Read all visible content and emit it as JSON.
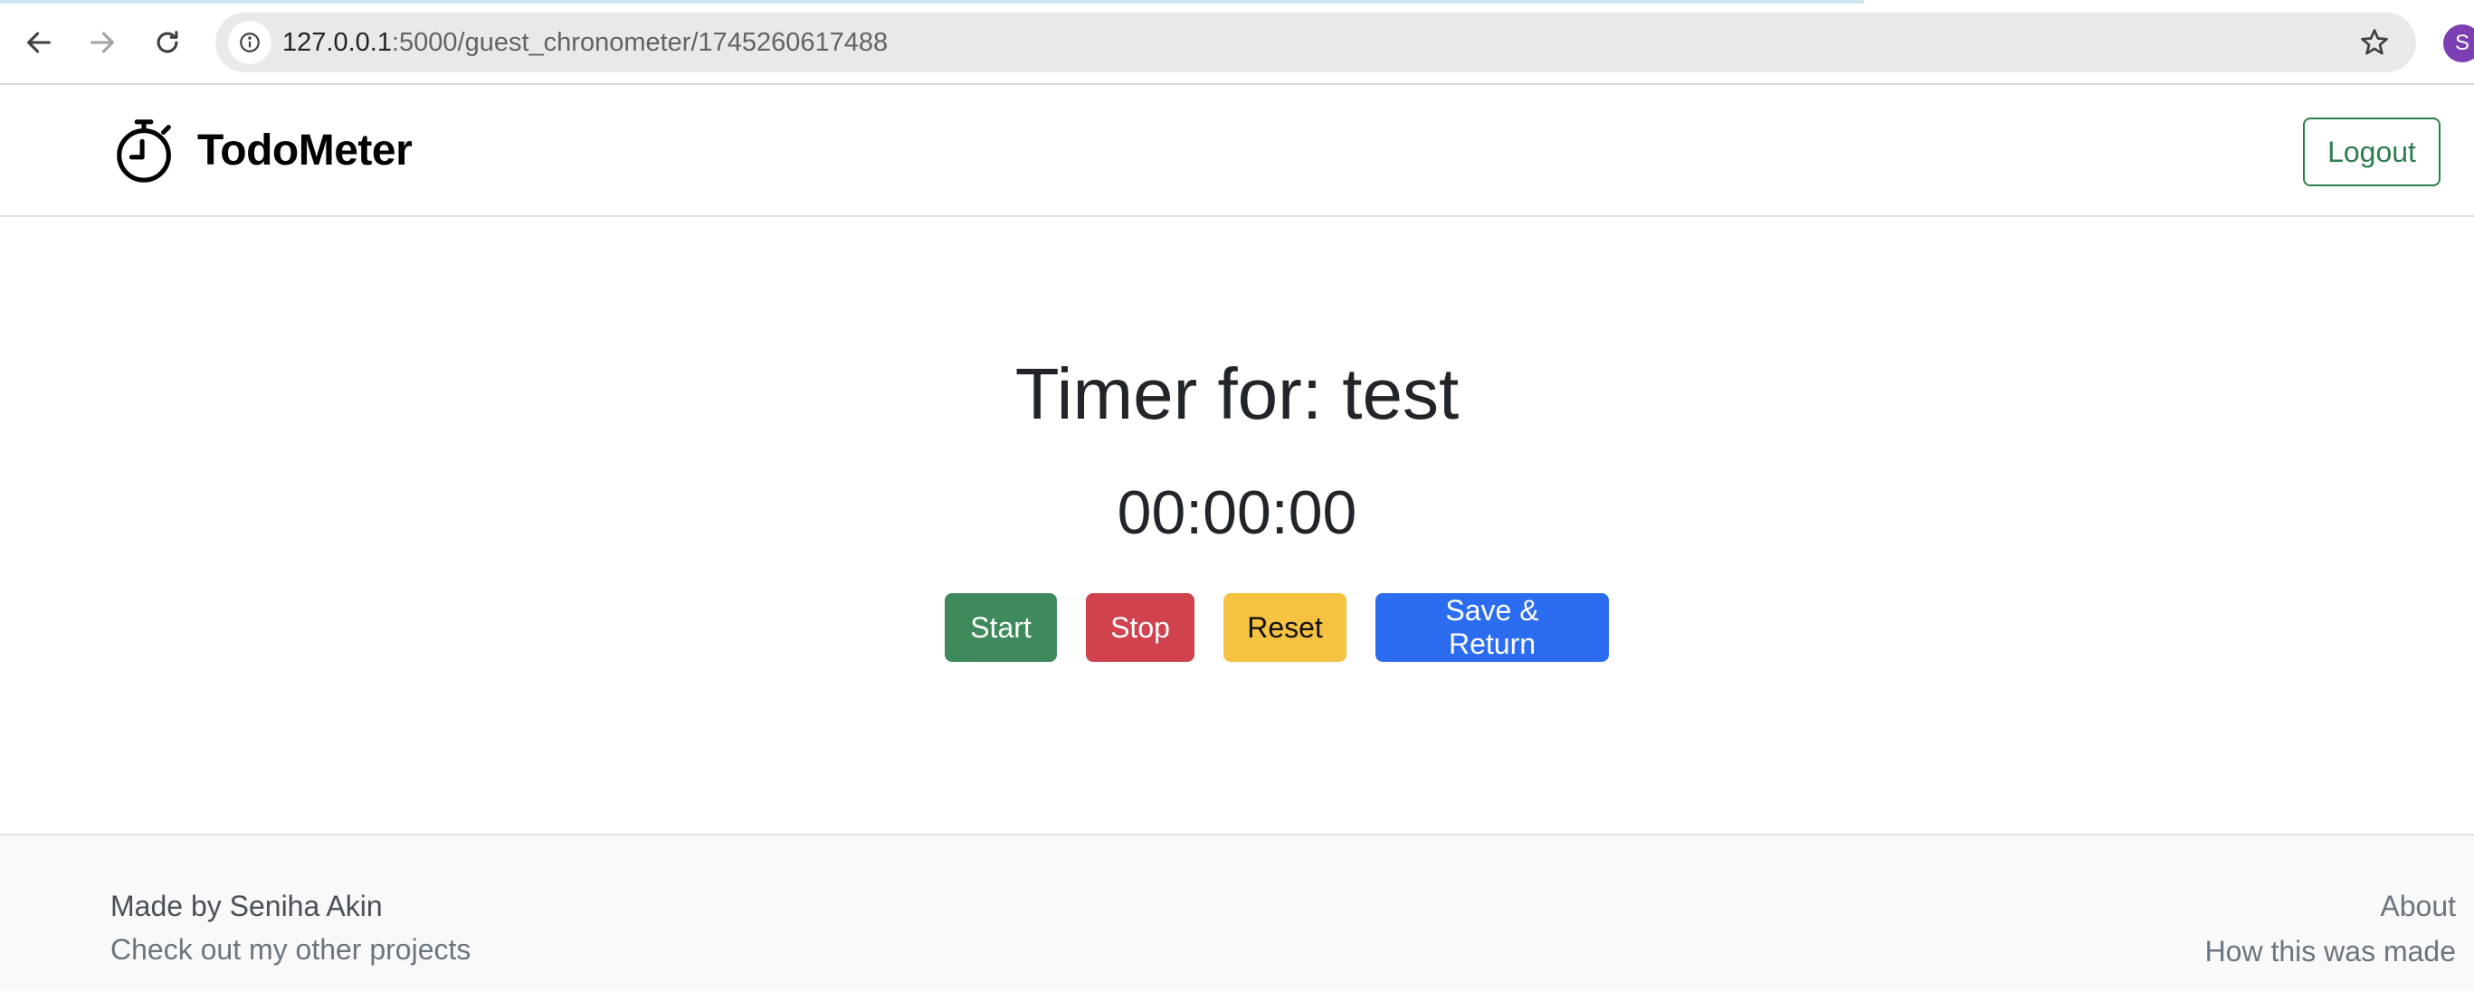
{
  "browser": {
    "url_host": "127.0.0.1",
    "url_rest": ":5000/guest_chronometer/1745260617488",
    "profile_initial": "S"
  },
  "header": {
    "brand_name": "TodoMeter",
    "logout_label": "Logout"
  },
  "timer": {
    "title_prefix": "Timer for: ",
    "task_name": "test",
    "display": "00:00:00",
    "buttons": {
      "start": "Start",
      "stop": "Stop",
      "reset": "Reset",
      "save": "Save & Return"
    }
  },
  "footer": {
    "credit": "Made by Seniha Akin",
    "projects_link": "Check out my other projects",
    "about_link": "About",
    "how_made_link": "How this was made"
  },
  "colors": {
    "start": "#3f8a5c",
    "stop": "#d0434e",
    "reset": "#f5c242",
    "save": "#2b6cf0",
    "outline_success": "#2e7d4f"
  }
}
